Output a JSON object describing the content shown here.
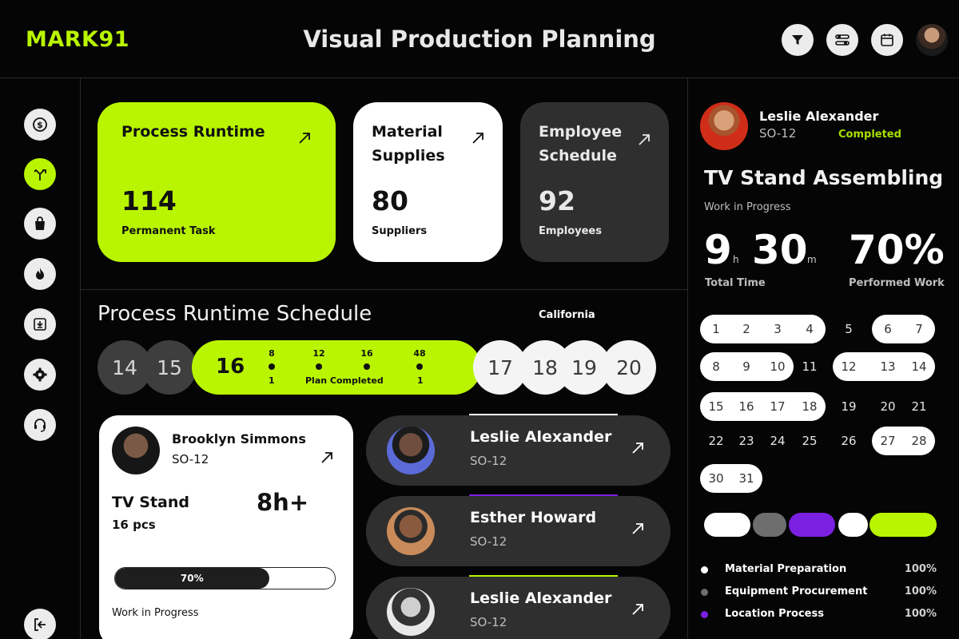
{
  "brand": "MARK91",
  "title": "Visual Production Planning",
  "icons": {
    "filter": "filter-icon",
    "sliders": "sliders-icon",
    "calendar": "calendar-icon",
    "user": "user-avatar"
  },
  "sidebar": [
    {
      "name": "dollar-icon"
    },
    {
      "name": "route-icon",
      "active": true
    },
    {
      "name": "bag-icon"
    },
    {
      "name": "fire-icon"
    },
    {
      "name": "download-icon"
    },
    {
      "name": "gear-icon"
    },
    {
      "name": "headset-icon"
    },
    {
      "name": "logout-icon"
    }
  ],
  "cards": [
    {
      "label": "Process Runtime",
      "value": "114",
      "sub": "Permanent Task"
    },
    {
      "label": "Material Supplies",
      "value": "80",
      "sub": "Suppliers"
    },
    {
      "label": "Employee Schedule",
      "value": "92",
      "sub": "Employees"
    }
  ],
  "schedule": {
    "title": "Process Runtime Schedule",
    "location": "California",
    "days_before": [
      "14",
      "15"
    ],
    "active_day": "16",
    "ticks": [
      "8",
      "12",
      "16",
      "48"
    ],
    "bottom_left": "1",
    "plan_label": "Plan Completed",
    "bottom_right": "1",
    "days_after": [
      "17",
      "18",
      "19",
      "20"
    ]
  },
  "task": {
    "name": "Brooklyn Simmons",
    "code": "SO-12",
    "product": "TV Stand",
    "qty": "16 pcs",
    "hours": "8h+",
    "progress_label": "70%",
    "progress": 0.7,
    "status": "Work in Progress"
  },
  "people": [
    {
      "name": "Leslie Alexander",
      "code": "SO-12",
      "line": "#ffffff"
    },
    {
      "name": "Esther Howard",
      "code": "SO-12",
      "line": "#7b1fe0"
    },
    {
      "name": "Leslie Alexander",
      "code": "SO-12",
      "line": "#b9f500"
    }
  ],
  "right_panel": {
    "name": "Leslie Alexander",
    "code": "SO-12",
    "status": "Completed",
    "title": "TV Stand Assembling",
    "subtitle": "Work in Progress",
    "hours": "9",
    "hours_unit": "h",
    "minutes": "30",
    "minutes_unit": "m",
    "time_caption": "Total Time",
    "percent": "70%",
    "percent_caption": "Performed Work"
  },
  "calendar": {
    "rows": [
      [
        "1",
        "2",
        "3",
        "4",
        "5",
        "6",
        "7"
      ],
      [
        "8",
        "9",
        "10",
        "11",
        "12",
        "13",
        "14"
      ],
      [
        "15",
        "16",
        "17",
        "18",
        "19",
        "20",
        "21"
      ],
      [
        "22",
        "23",
        "24",
        "25",
        "26",
        "27",
        "28"
      ],
      [
        "30",
        "31"
      ]
    ]
  },
  "legend": [
    {
      "label": "Material Preparation",
      "value": "100%",
      "color": "#ffffff"
    },
    {
      "label": "Equipment Procurement",
      "value": "100%",
      "color": "#6e6e6e"
    },
    {
      "label": "Location Process",
      "value": "100%",
      "color": "#7b1fe0"
    }
  ],
  "colors": {
    "accent": "#b9f500",
    "purple": "#7b1fe0",
    "dark_card": "#2f2f2f"
  }
}
